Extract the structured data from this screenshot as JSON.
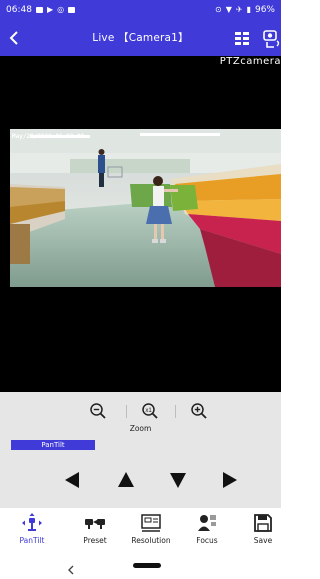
{
  "status_bar": {
    "time": "06:48",
    "battery": "96%"
  },
  "app_bar": {
    "title": "Live 【Camera1】",
    "back_icon": "back-chevron-icon",
    "grid_icon": "grid-view-icon",
    "camera_icon": "camera-settings-icon"
  },
  "video": {
    "overlay_label": "PTZcamera",
    "osd_timestamp": "May/29/2020 06:03:08"
  },
  "zoom": {
    "label": "Zoom",
    "icons": [
      "zoom-out-icon",
      "zoom-reset-icon",
      "zoom-in-icon"
    ]
  },
  "pantilt": {
    "tab_label": "PanTilt",
    "directions": [
      "left",
      "up",
      "down",
      "right"
    ]
  },
  "bottom_nav": {
    "items": [
      {
        "label": "PanTilt",
        "icon": "pantilt-icon",
        "active": true
      },
      {
        "label": "Preset",
        "icon": "preset-icon",
        "active": false
      },
      {
        "label": "Resolution",
        "icon": "resolution-icon",
        "active": false
      },
      {
        "label": "Focus",
        "icon": "focus-icon",
        "active": false
      },
      {
        "label": "Save",
        "icon": "save-icon",
        "active": false
      }
    ]
  },
  "colors": {
    "accent": "#3f3ad8",
    "panel": "#e6e6e6"
  }
}
